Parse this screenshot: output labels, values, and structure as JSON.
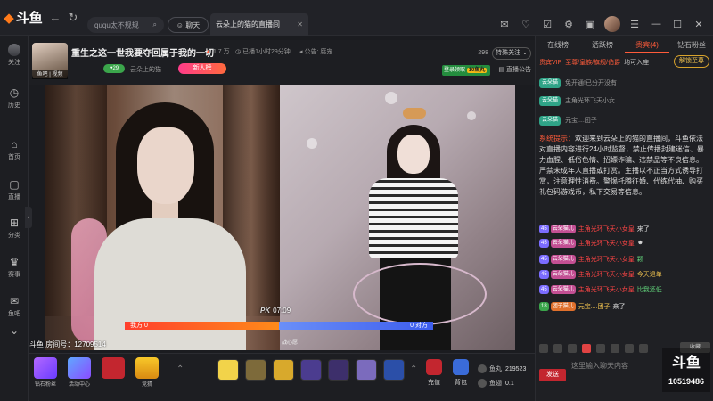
{
  "topbar": {
    "logo_text": "斗鱼",
    "search_text": "ququ太不规规",
    "chat_button": "聊天",
    "tab_title": "云朵上的猫的直播间"
  },
  "sidebar": {
    "items": [
      {
        "label": "关注",
        "icon": "avatar-icon"
      },
      {
        "label": "历史",
        "icon": "history-icon"
      },
      {
        "label": "首页",
        "icon": "home-icon"
      },
      {
        "label": "直播",
        "icon": "live-icon"
      },
      {
        "label": "分类",
        "icon": "category-icon"
      },
      {
        "label": "赛事",
        "icon": "trophy-icon"
      },
      {
        "label": "鱼吧",
        "icon": "forum-icon"
      }
    ]
  },
  "room": {
    "title": "重生之这一世我要夺回属于我的一切",
    "heat": "1.7 万",
    "live_time": "已播1小时29分钟",
    "announcement_short": "公告: 腐宠",
    "avatar_tag": "鱼吧 | 视频",
    "level": "29",
    "anchor_name": "云朵上的猫",
    "rank_badge": "新人榜",
    "fans_count": "298",
    "follow_label": "特殊关注",
    "gift_badge_text": "登录领取",
    "gift_badge_amount": "10鱼丸",
    "announce_label": "直播公告",
    "room_number": "斗鱼 房间号：12709514"
  },
  "pk": {
    "left_label": "我方 0",
    "right_label": "0 对方",
    "pk_text": "PK",
    "timer": "07:09",
    "tag": "战心愿"
  },
  "giftbar": {
    "fans_label": "钻石粉丝",
    "activity_label": "活动中心",
    "gift_label": "",
    "rank_label": "竞猜",
    "recharge_label": "充值",
    "bag_label": "背包",
    "fish_ball_label": "鱼丸",
    "fish_ball_value": "219523",
    "fish_wing_label": "鱼翅",
    "fish_wing_value": "0.1"
  },
  "chat": {
    "tabs": [
      "在线榜",
      "活跃榜",
      "贵宾(4)",
      "钻石粉丝"
    ],
    "vip_prefix": "贵宾VIP",
    "vip_text": "至尊/皇族/旗舰/伯爵",
    "vip_suffix": "均可入座",
    "vip_button": "解锁至尊",
    "fans_rows": [
      {
        "tag": "云朵猫",
        "text": "免开通!已分开没有"
      },
      {
        "tag": "云朵猫",
        "text": "主角光环飞天小女..."
      },
      {
        "tag": "云朵猫",
        "text": "元宝....团子"
      }
    ],
    "system_label": "系统提示：",
    "system_text": "欢迎来到云朵上的猫的直播间，斗鱼依法对直播内容进行24小时监督，禁止传播封建迷信、暴力血腥、低俗色情、招嫖诈骗、违禁品等不良信息。严禁未成年人直播或打赏。主播以不正当方式诱导打赏，注意理性消费。警惕托腾征婚、代练代抽、购买礼包码游戏币，私下交易等信息。",
    "messages": [
      {
        "lv": "45",
        "badge": "云朵猫儿",
        "name": "主角光环飞天小女皇",
        "text": "来了"
      },
      {
        "lv": "45",
        "badge": "云朵猫儿",
        "name": "主角光环飞天小女皇",
        "text": ""
      },
      {
        "lv": "45",
        "badge": "云朵猫儿",
        "name": "主角光环飞天小女皇",
        "text": "颗"
      },
      {
        "lv": "45",
        "badge": "云朵猫儿",
        "name": "主角光环飞天小女皇",
        "text": "今天退单"
      },
      {
        "lv": "45",
        "badge": "云朵猫儿",
        "name": "主角光环飞天小女皇",
        "text": "比我还低"
      },
      {
        "lv": "18",
        "badge": "团子猫儿",
        "name": "元宝....团子",
        "text": "来了"
      }
    ],
    "input_placeholder": "这里输入聊天内容",
    "send_label": "发送",
    "collect_label": "收藏",
    "watermark_number": "10519486"
  }
}
